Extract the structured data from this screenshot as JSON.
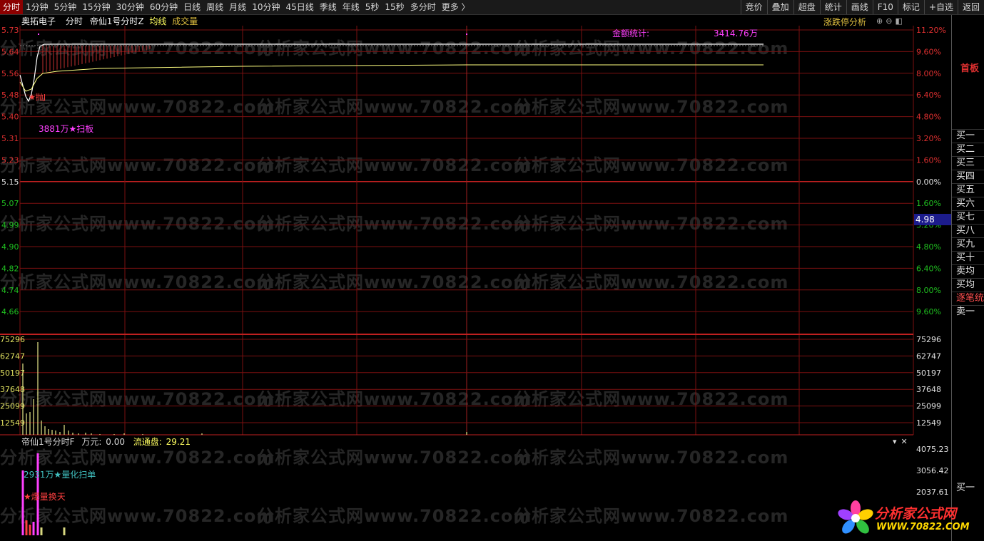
{
  "toolbar": {
    "periods": [
      "分时",
      "1分钟",
      "5分钟",
      "15分钟",
      "30分钟",
      "60分钟",
      "日线",
      "周线",
      "月线",
      "10分钟",
      "45日线",
      "季线",
      "年线",
      "5秒",
      "15秒",
      "多分时",
      "更多 〉"
    ],
    "active_period": "分时",
    "tools": [
      "竞价",
      "叠加",
      "超盘",
      "统计",
      "画线",
      "F10",
      "标记",
      "+自选",
      "返回"
    ]
  },
  "header": {
    "stock_name": "奥拓电子",
    "mode": "分时",
    "indicator": "帝仙1号分时Z",
    "avg_label": "均线",
    "vol_label": "成交量",
    "limit_analysis": "涨跌停分析",
    "icons": [
      "zoom-in-icon",
      "zoom-out-icon",
      "panel-icon"
    ]
  },
  "price_chart": {
    "amount_label": "金额统计:",
    "amount_value": "3414.76",
    "amount_unit": "万",
    "annotations": [
      "★抛J",
      "3881万★扫板"
    ],
    "price_ticks": [
      "5.73",
      "5.64",
      "5.56",
      "5.48",
      "5.40",
      "5.31",
      "5.23",
      "5.15",
      "5.07",
      "4.99",
      "4.90",
      "4.82",
      "4.74",
      "4.66"
    ],
    "pct_ticks": [
      "11.20%",
      "9.60%",
      "8.00%",
      "6.40%",
      "4.80%",
      "3.20%",
      "1.60%",
      "0.00%",
      "1.60%",
      "3.20%",
      "4.80%",
      "6.40%",
      "8.00%",
      "9.60%"
    ],
    "current_price": "4.98"
  },
  "volume_chart": {
    "left_ticks": [
      "75296",
      "62747",
      "50197",
      "37648",
      "25099",
      "12549"
    ],
    "right_ticks": [
      "75296",
      "62747",
      "50197",
      "37648",
      "25099",
      "12549"
    ]
  },
  "indicator_panel": {
    "name": "帝仙1号分时F",
    "wan_label": "万元:",
    "wan_value": "0.00",
    "float_label": "流通盘:",
    "float_value": "29.21",
    "icons": [
      "dropdown-icon",
      "close-icon"
    ],
    "annotations": [
      "2931万★量化扫单",
      "★爆量换天"
    ],
    "right_ticks": [
      "4075.23",
      "3056.42",
      "2037.61"
    ]
  },
  "right_panel": {
    "badge": "首板",
    "orderbook": [
      "买一",
      "买二",
      "买三",
      "买四",
      "买五",
      "买六",
      "买七",
      "买八",
      "买九",
      "买十",
      "卖均",
      "买均",
      "逐笔统",
      "卖一"
    ],
    "bottom_item": "买一"
  },
  "watermark": "分析家公式网www.70822.com",
  "logo": {
    "text": "分析家公式网",
    "url": "WWW.70822.COM"
  },
  "colors": {
    "grid": "#7a1010",
    "up": "#e03030",
    "down": "#20c020",
    "flat": "#e0e0e0",
    "price_line": "#ffffff",
    "avg_line": "#ffff80",
    "magenta": "#ff40ff",
    "volume": "#d8d880"
  }
}
